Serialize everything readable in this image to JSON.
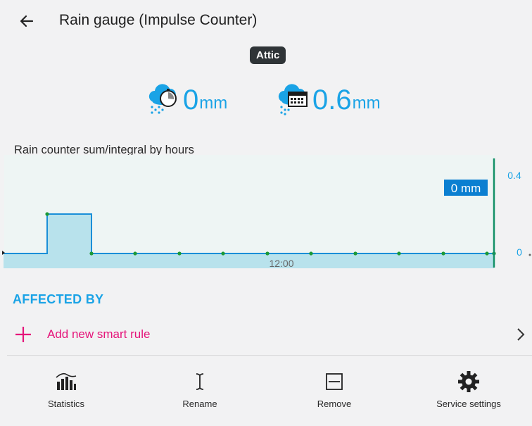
{
  "header": {
    "title": "Rain gauge (Impulse Counter)",
    "back_icon": "arrow-left-icon"
  },
  "room_badge": "Attic",
  "metrics": [
    {
      "icon": "rain-cloud-timer-icon",
      "value": "0",
      "unit": "mm"
    },
    {
      "icon": "rain-cloud-calendar-icon",
      "value": "0.6",
      "unit": "mm"
    }
  ],
  "chart_title": "Rain counter sum/integral by hours",
  "chart_data": {
    "type": "area",
    "step": true,
    "x_tick_label": "12:00",
    "ylabels": [
      "0.4",
      "0"
    ],
    "ylim": [
      0,
      0.4
    ],
    "points": [
      0,
      0.2,
      0,
      0,
      0,
      0,
      0,
      0,
      0,
      0,
      0,
      0
    ],
    "cursor_label": "0 mm",
    "colors": {
      "line": "#1a8fd8",
      "fill": "#b8e2ec",
      "point": "#1c9a36",
      "cursor": "#139066"
    }
  },
  "affected_by": {
    "heading": "AFFECTED BY",
    "add_rule_label": "Add new smart rule"
  },
  "toolbar": {
    "items": [
      {
        "label": "Statistics",
        "icon": "bar-chart-icon"
      },
      {
        "label": "Rename",
        "icon": "text-cursor-icon"
      },
      {
        "label": "Remove",
        "icon": "remove-box-icon"
      },
      {
        "label": "Service settings",
        "icon": "gear-icon"
      }
    ]
  },
  "colors": {
    "accent": "#1aa3e6",
    "pink": "#e5157a",
    "badge_bg": "#2f3437"
  }
}
